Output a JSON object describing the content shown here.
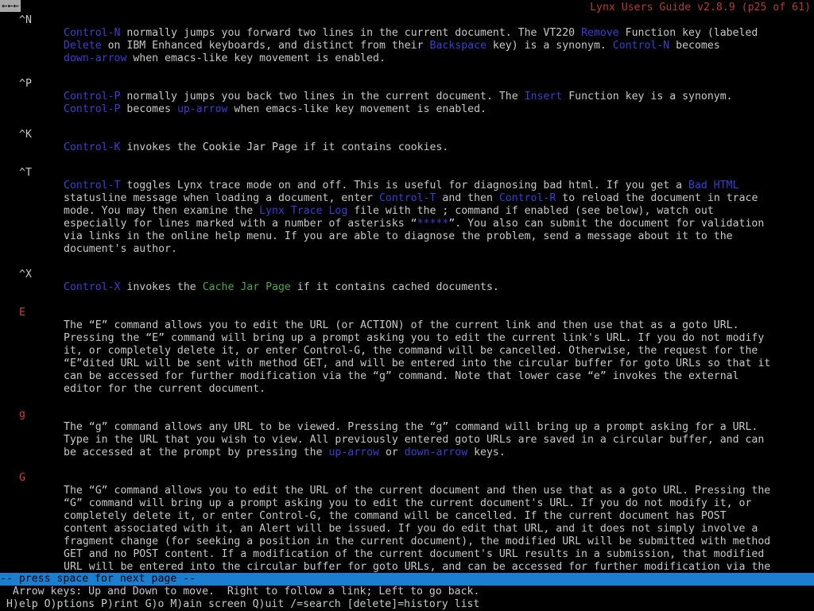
{
  "back_label": "←←←",
  "doc_title": "Lynx Users Guide v2.8.9 (p25 of 61)",
  "sections": {
    "ctrl_n": {
      "key": "^N",
      "l1": [
        "Control-N",
        " normally jumps you forward two lines in the current document. The VT220 ",
        "Remove",
        " Function key (labeled"
      ],
      "l2": [
        "Delete",
        " on IBM Enhanced keyboards, and distinct from their ",
        "Backspace",
        " key) is a synonym. ",
        "Control-N",
        " becomes"
      ],
      "l3": [
        "down-arrow",
        " when emacs-like key movement is enabled."
      ]
    },
    "ctrl_p": {
      "key": "^P",
      "l1": [
        "Control-P",
        " normally jumps you back two lines in the current document. The ",
        "Insert",
        " Function key is a synonym."
      ],
      "l2": [
        "Control-P",
        " becomes ",
        "up-arrow",
        " when emacs-like key movement is enabled."
      ]
    },
    "ctrl_k": {
      "key": "^K",
      "l1": [
        "Control-K",
        " invokes the ",
        "Cookie Jar Page",
        " if it contains cookies."
      ]
    },
    "ctrl_t": {
      "key": "^T",
      "l1": [
        "Control-T",
        " toggles Lynx trace mode on and off. This is useful for diagnosing bad html. If you get a ",
        "Bad HTML"
      ],
      "l2": [
        "statusline message when loading a document, enter ",
        "Control-T",
        " and then ",
        "Control-R",
        " to reload the document in trace"
      ],
      "l3": [
        "mode. You may then examine the ",
        "Lynx Trace Log",
        " file with the ; command if enabled (see below), watch out"
      ],
      "l4": [
        "especially for lines marked with a number of asterisks “",
        "*****",
        "”. You also can submit the document for validation"
      ],
      "l5": "via links in the online help menu. If you are able to diagnose the problem, send a message about it to the",
      "l6": "document's author."
    },
    "ctrl_x": {
      "key": "^X",
      "l1": [
        "Control-X",
        " invokes the ",
        "Cache Jar Page",
        " if it contains cached documents."
      ]
    },
    "cmd_E": {
      "key": "E",
      "lines": [
        "The “E” command allows you to edit the URL (or ACTION) of the current link and then use that as a goto URL.",
        "Pressing the “E” command will bring up a prompt asking you to edit the current link's URL. If you do not modify",
        "it, or completely delete it, or enter Control-G, the command will be cancelled. Otherwise, the request for the",
        "“E”dited URL will be sent with method GET, and will be entered into the circular buffer for goto URLs so that it",
        "can be accessed for further modification via the “g” command. Note that lower case “e” invokes the external",
        "editor for the current document."
      ]
    },
    "cmd_g": {
      "key": "g",
      "l1": "The “g” command allows any URL to be viewed. Pressing the “g” command will bring up a prompt asking for a URL.",
      "l2": "Type in the URL that you wish to view. All previously entered goto URLs are saved in a circular buffer, and can",
      "l3": [
        "be accessed at the prompt by pressing the ",
        "up-arrow",
        " or ",
        "down-arrow",
        " keys."
      ]
    },
    "cmd_G": {
      "key": "G",
      "lines": [
        "The “G” command allows you to edit the URL of the current document and then use that as a goto URL. Pressing the",
        "“G” command will bring up a prompt asking you to edit the current document's URL. If you do not modify it, or",
        "completely delete it, or enter Control-G, the command will be cancelled. If the current document has POST",
        "content associated with it, an Alert will be issued. If you do edit that URL, and it does not simply involve a",
        "fragment change (for seeking a position in the current document), the modified URL will be submitted with method",
        "GET and no POST content. If a modification of the current document's URL results in a submission, that modified",
        "URL will be entered into the circular buffer for goto URLs, and can be accessed for further modification via the"
      ]
    }
  },
  "statusbar": "-- press space for next page --",
  "help_line1": "  Arrow keys: Up and Down to move.  Right to follow a link; Left to go back.",
  "help_line2": " H)elp O)ptions P)rint G)o M)ain screen Q)uit /=search [delete]=history list"
}
